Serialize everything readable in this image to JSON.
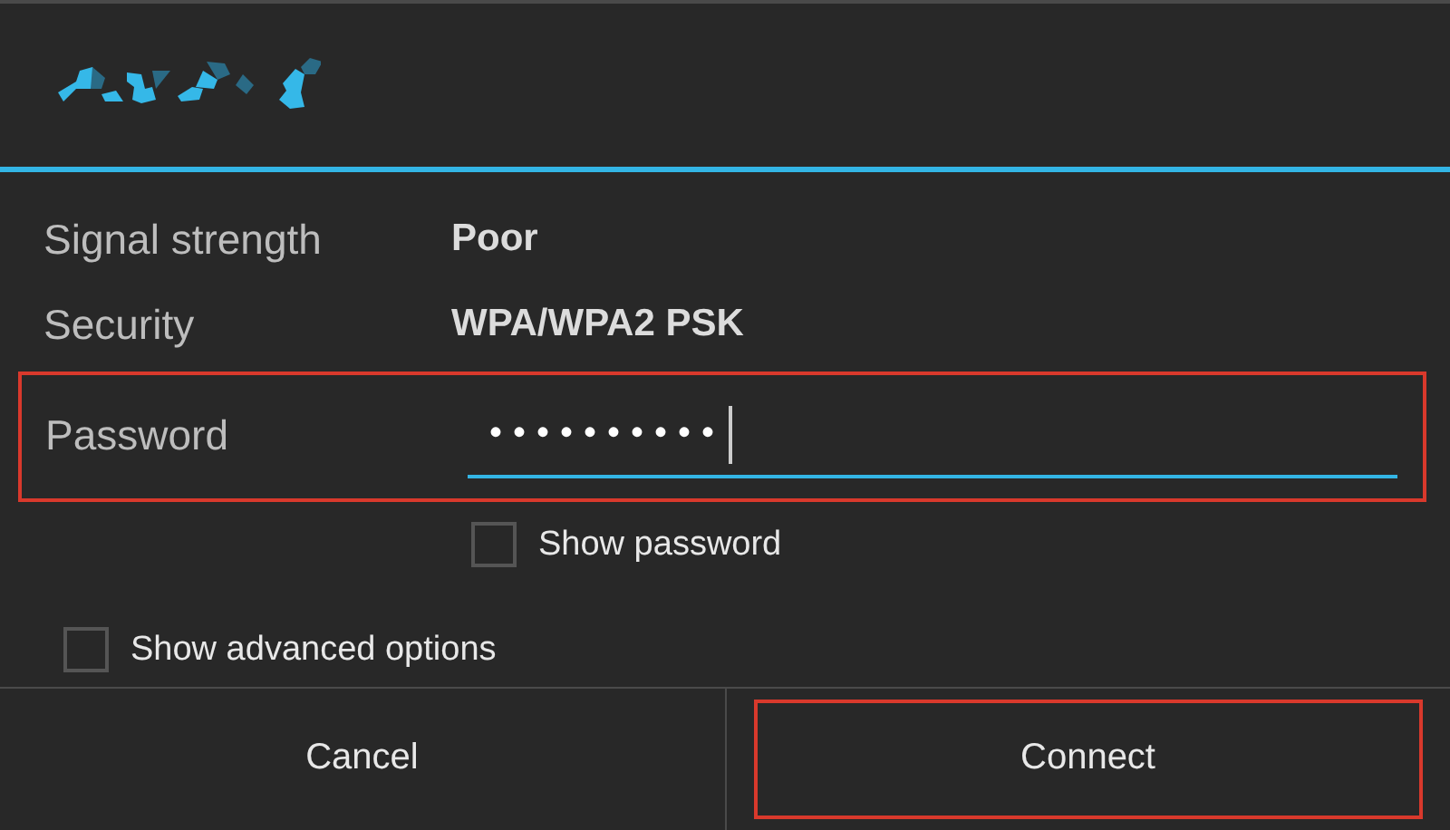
{
  "dialog": {
    "title": {
      "kind": "redacted"
    },
    "details": [
      {
        "label": "Signal strength",
        "value": "Poor"
      },
      {
        "label": "Security",
        "value": "WPA/WPA2 PSK"
      }
    ],
    "password": {
      "label": "Password",
      "value": "••••••••••",
      "focused": true,
      "highlighted": true
    },
    "checkboxes": [
      {
        "label": "Show password",
        "checked": false,
        "indent": true
      },
      {
        "label": "Show advanced options",
        "checked": false,
        "indent": false
      }
    ],
    "buttons": [
      {
        "label": "Cancel",
        "highlighted": false
      },
      {
        "label": "Connect",
        "highlighted": true
      }
    ]
  }
}
